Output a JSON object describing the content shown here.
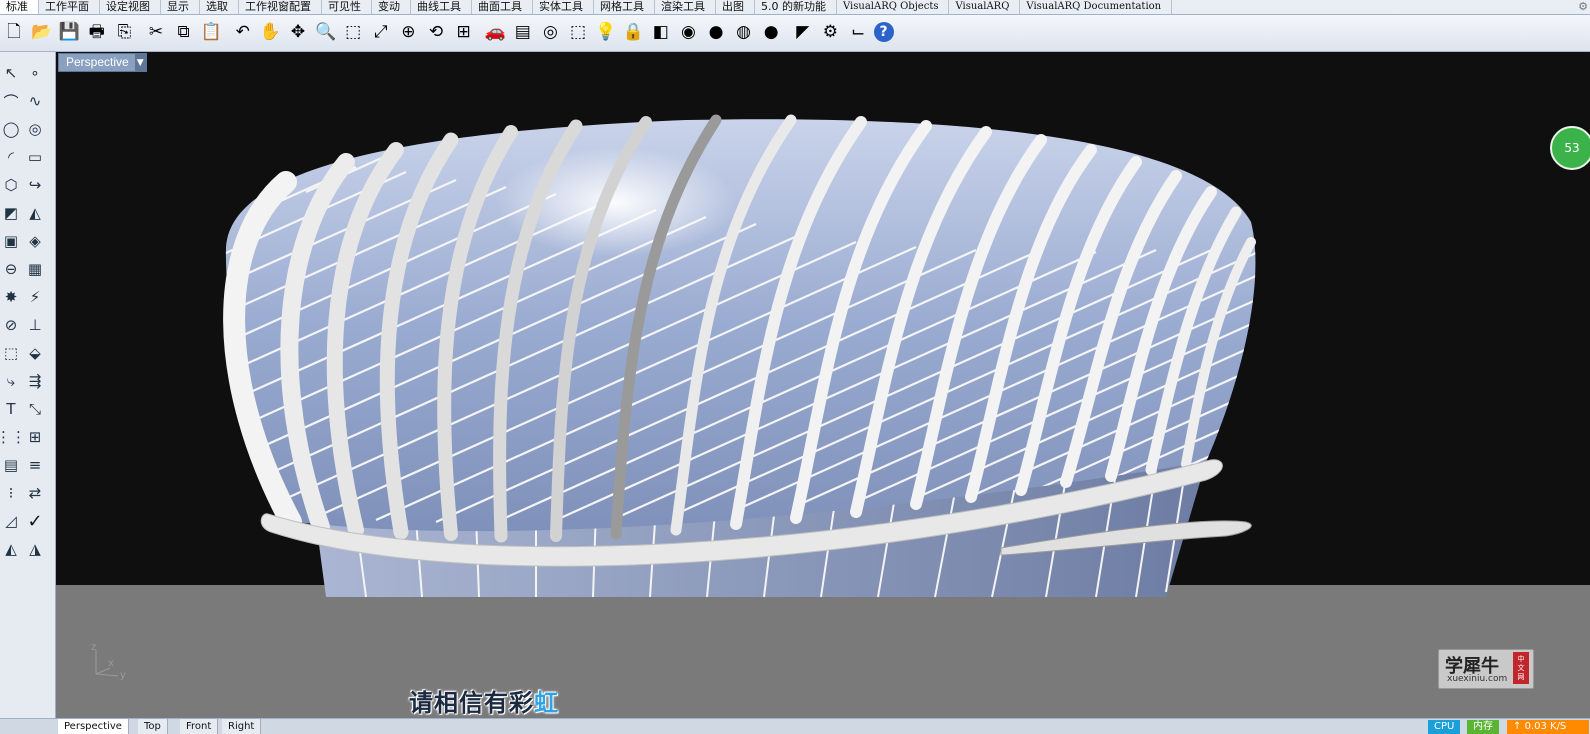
{
  "tabs": [
    {
      "label": "标准",
      "active": true
    },
    {
      "label": "工作平面"
    },
    {
      "label": "设定视图"
    },
    {
      "label": "显示"
    },
    {
      "label": "选取"
    },
    {
      "label": "工作视窗配置"
    },
    {
      "label": "可见性"
    },
    {
      "label": "变动"
    },
    {
      "label": "曲线工具"
    },
    {
      "label": "曲面工具"
    },
    {
      "label": "实体工具"
    },
    {
      "label": "网格工具"
    },
    {
      "label": "渲染工具"
    },
    {
      "label": "出图"
    },
    {
      "label": "5.0 的新功能"
    },
    {
      "label": "VisualARQ Objects"
    },
    {
      "label": "VisualARQ"
    },
    {
      "label": "VisualARQ Documentation"
    }
  ],
  "toolbar_icons": [
    {
      "name": "new-file-icon",
      "glyph": "🗋"
    },
    {
      "name": "open-folder-icon",
      "glyph": "📂"
    },
    {
      "name": "save-icon",
      "glyph": "💾"
    },
    {
      "name": "print-icon",
      "glyph": "🖶"
    },
    {
      "name": "import-icon",
      "glyph": "⎘"
    },
    {
      "name": "cut-icon",
      "glyph": "✂"
    },
    {
      "name": "copy-icon",
      "glyph": "⧉"
    },
    {
      "name": "paste-icon",
      "glyph": "📋"
    },
    {
      "name": "undo-icon",
      "glyph": "↶"
    },
    {
      "name": "pan-hand-icon",
      "glyph": "✋"
    },
    {
      "name": "rotate-view-icon",
      "glyph": "✥"
    },
    {
      "name": "zoom-icon",
      "glyph": "🔍"
    },
    {
      "name": "zoom-window-icon",
      "glyph": "⬚"
    },
    {
      "name": "zoom-extents-icon",
      "glyph": "⤢"
    },
    {
      "name": "zoom-selected-icon",
      "glyph": "⊕"
    },
    {
      "name": "undo-view-icon",
      "glyph": "⟲"
    },
    {
      "name": "four-viewports-icon",
      "glyph": "⊞"
    },
    {
      "name": "car-icon",
      "glyph": "🚗"
    },
    {
      "name": "named-views-icon",
      "glyph": "▤"
    },
    {
      "name": "osnap-icon",
      "glyph": "◎"
    },
    {
      "name": "select-filter-icon",
      "glyph": "⬚"
    },
    {
      "name": "light-bulb-icon",
      "glyph": "💡"
    },
    {
      "name": "lock-icon",
      "glyph": "🔒"
    },
    {
      "name": "layer-icon",
      "glyph": "◧"
    },
    {
      "name": "color-wheel-icon",
      "glyph": "◉"
    },
    {
      "name": "shaded-sphere-icon",
      "glyph": "●"
    },
    {
      "name": "rendered-sphere-icon",
      "glyph": "◍"
    },
    {
      "name": "render-icon",
      "glyph": "●"
    },
    {
      "name": "lamp-icon",
      "glyph": "◤"
    },
    {
      "name": "options-gear-icon",
      "glyph": "⚙"
    },
    {
      "name": "dimension-icon",
      "glyph": "⌙"
    },
    {
      "name": "help-icon",
      "glyph": "?"
    }
  ],
  "palette_icons": [
    "select-arrow-icon",
    "point-icon",
    "polyline-icon",
    "curve-icon",
    "circle-icon",
    "ellipse-icon",
    "arc-icon",
    "rectangle-icon",
    "polygon-icon",
    "fillet-curve-icon",
    "surface-corner-icon",
    "extrude-surface-icon",
    "box-icon",
    "solid-union-icon",
    "cylinder-icon",
    "mesh-icon",
    "explode-icon",
    "split-icon",
    "boolean-split-icon",
    "trim-icon",
    "group-icon",
    "ungroup-icon",
    "fillet-icon",
    "offset-icon",
    "text-icon",
    "scale-icon",
    "array-icon",
    "move-icon",
    "block-icon",
    "hatch-icon",
    "grid-icon",
    "align-icon",
    "dimension-tool-icon",
    "check-icon",
    "shade-icon",
    "paint-bucket-icon"
  ],
  "viewport": {
    "title": "Perspective",
    "subtitle_main": "请相信有彩",
    "subtitle_highlight": "虹",
    "badge_text": "53",
    "watermark_cn": "学犀牛",
    "watermark_en": "xuexiniu.com",
    "watermark_tag": "中文网",
    "axis_z": "z",
    "axis_x": "x",
    "axis_y": "y"
  },
  "bottom_tabs": [
    "Perspective",
    "Top",
    "Front",
    "Right"
  ],
  "status": {
    "cpu": "CPU",
    "mem": "内存",
    "speed": "0.03 K/S"
  },
  "colors": {
    "sky": "#0f0f0f",
    "ground": "#7a7a7a",
    "glass": "#9fb0d4",
    "ribs": "#f2f2f2",
    "cpu": "#1b9fd8",
    "mem": "#5bb534",
    "speed": "#ff8a00"
  }
}
